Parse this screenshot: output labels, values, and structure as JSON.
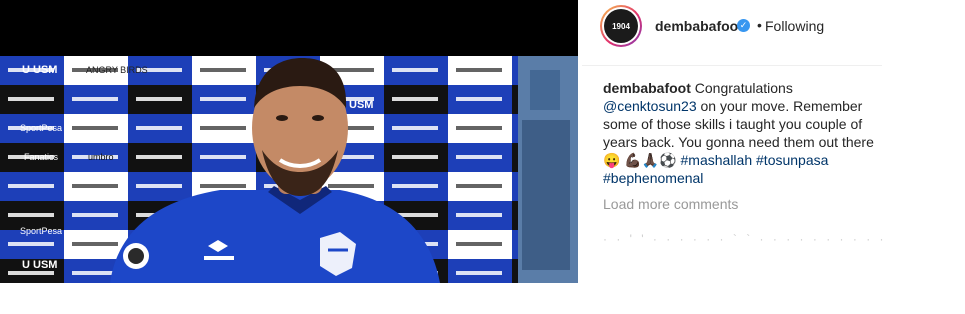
{
  "post": {
    "username": "dembabafoot",
    "avatar_text": "1904",
    "verified_icon": "verified-badge-icon",
    "follow_status": "Following",
    "caption": {
      "username": "dembabafoot",
      "text_1": "Congratulations",
      "mention": "@cenktosun23",
      "text_2": "on your move. Remember some of those skills i taught you couple of years back. You gonna need them out there",
      "emojis": "😛 💪🏿🙏🏿⚽",
      "hashtag_1": "#mashallah",
      "hashtag_2": "#tosunpasa",
      "hashtag_3": "#bephenomenal"
    },
    "load_more_label": "Load more comments"
  },
  "photo": {
    "board_logos": [
      "U USM",
      "ANGRY BIRDS",
      "SportPesa",
      "Fanatics",
      "umbro"
    ]
  },
  "colors": {
    "everton_blue": "#1d3fb8",
    "link": "#003569",
    "muted_text": "#999999",
    "verified_badge": "#3897f0"
  }
}
